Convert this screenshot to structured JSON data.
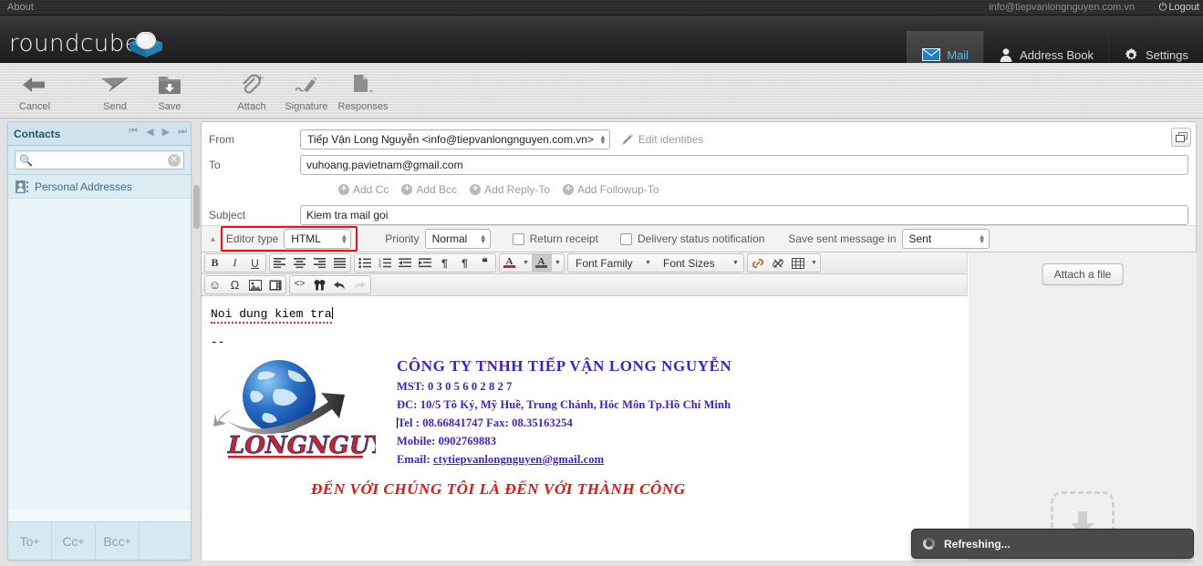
{
  "topbar": {
    "about": "About",
    "username": "info@tiepvanlongnguyen.com.vn",
    "logout": "Logout",
    "power_icon": "power-icon"
  },
  "header": {
    "logo_text": "roundcube",
    "taskbar": [
      {
        "label": "Mail",
        "icon": "envelope-icon",
        "selected": true
      },
      {
        "label": "Address Book",
        "icon": "person-icon",
        "selected": false
      },
      {
        "label": "Settings",
        "icon": "gear-icon",
        "selected": false
      }
    ]
  },
  "toolbar": [
    {
      "label": "Cancel",
      "icon": "back-arrow-icon"
    },
    {
      "label": "Send",
      "icon": "paper-plane-icon"
    },
    {
      "label": "Save",
      "icon": "save-folder-icon"
    },
    {
      "label": "Attach",
      "icon": "paperclip-plus-icon"
    },
    {
      "label": "Signature",
      "icon": "pen-icon"
    },
    {
      "label": "Responses",
      "icon": "document-dropdown-icon"
    }
  ],
  "sidebar": {
    "title": "Contacts",
    "pager": [
      "first-page-icon",
      "prev-page-icon",
      "next-page-icon",
      "last-page-icon"
    ],
    "search_placeholder": "",
    "search_value": "",
    "groups": [
      {
        "label": "Personal Addresses",
        "icon": "contact-card-icon"
      }
    ],
    "footer_buttons": [
      "To",
      "Cc",
      "Bcc"
    ]
  },
  "compose": {
    "from_label": "From",
    "from_value": "Tiếp Vận Long Nguyễn <info@tiepvanlongnguyen.com.vn>",
    "edit_identities": "Edit identities",
    "to_label": "To",
    "to_value": "vuhoang.pavietnam@gmail.com",
    "cc_links": [
      "Add Cc",
      "Add Bcc",
      "Add Reply-To",
      "Add Followup-To"
    ],
    "subject_label": "Subject",
    "subject_value": "Kiem tra mail goi",
    "maximize_icon": "restore-window-icon",
    "options": {
      "editor_type_label": "Editor type",
      "editor_type_value": "HTML",
      "priority_label": "Priority",
      "priority_value": "Normal",
      "return_receipt_label": "Return receipt",
      "dsn_label": "Delivery status notification",
      "save_sent_label": "Save sent message in",
      "save_sent_value": "Sent",
      "highlight_color": "#ee1111"
    }
  },
  "editor_toolbar": {
    "row1": [
      {
        "icon": "bold-icon",
        "glyph": "B"
      },
      {
        "icon": "italic-icon",
        "glyph": "I"
      },
      {
        "icon": "underline-icon",
        "glyph": "U"
      },
      {
        "icon": "align-left-icon"
      },
      {
        "icon": "align-center-icon"
      },
      {
        "icon": "align-right-icon"
      },
      {
        "icon": "align-justify-icon"
      },
      {
        "icon": "bullet-list-icon"
      },
      {
        "icon": "numbered-list-icon"
      },
      {
        "icon": "outdent-icon"
      },
      {
        "icon": "indent-icon"
      },
      {
        "icon": "ltr-paragraph-icon",
        "glyph": "¶"
      },
      {
        "icon": "rtl-paragraph-icon",
        "glyph": "¶"
      },
      {
        "icon": "blockquote-icon",
        "glyph": "❝"
      },
      {
        "icon": "text-color-icon",
        "glyph": "A"
      },
      {
        "icon": "background-color-icon",
        "glyph": "A"
      }
    ],
    "font_family_label": "Font Family",
    "font_sizes_label": "Font Sizes",
    "row1_tail": [
      {
        "icon": "link-icon"
      },
      {
        "icon": "unlink-icon"
      },
      {
        "icon": "table-icon"
      }
    ],
    "row2": [
      {
        "icon": "emoticon-icon",
        "glyph": "☺"
      },
      {
        "icon": "special-char-icon",
        "glyph": "Ω"
      },
      {
        "icon": "image-icon"
      },
      {
        "icon": "media-icon"
      },
      {
        "icon": "source-code-icon",
        "glyph": "<>"
      },
      {
        "icon": "search-replace-icon"
      },
      {
        "icon": "undo-icon",
        "glyph": "↶"
      },
      {
        "icon": "redo-icon",
        "glyph": "↷",
        "disabled": true
      }
    ]
  },
  "message_body": {
    "line1": "Noi dung kiem tra",
    "separator": "--",
    "signature": {
      "logo_word": "LONGNGUYEN",
      "company": "CÔNG TY TNHH TIẾP VẬN LONG NGUYỄN",
      "mst": "MST: 0 3 0 5 6 0 2 8 2 7",
      "address": "ĐC: 10/5 Tô Ký, Mỹ Huề, Trung Chánh, Hóc Môn Tp.Hồ Chí Minh",
      "tel": "Tel : 08.66841747  Fax: 08.35163254",
      "mobile": "Mobile: 0902769883",
      "email_label": "Email: ",
      "email": "ctytiepvanlongnguyen@gmail.com",
      "slogan": "ĐẾN VỚI CHÚNG TÔI LÀ ĐẾN VỚI THÀNH CÔNG",
      "text_color": "#3f1fd0",
      "slogan_color": "#e81313"
    }
  },
  "attachments": {
    "attach_button": "Attach a file",
    "dropzone_icon": "download-arrow-icon"
  },
  "toast": {
    "message": "Refreshing...",
    "icon": "spinner-icon"
  }
}
